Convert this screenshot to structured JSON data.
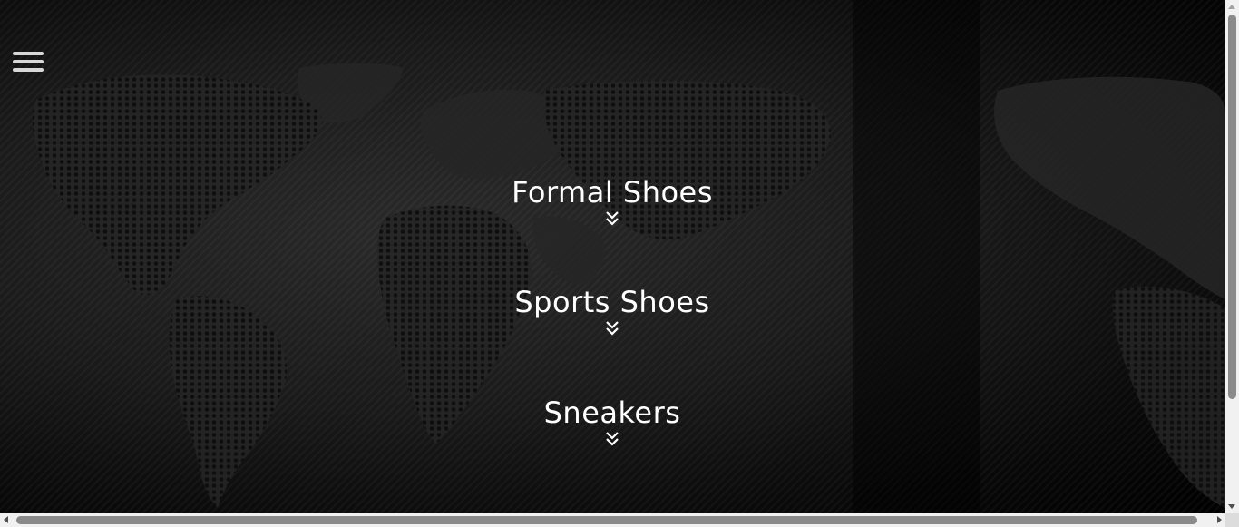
{
  "nav": {
    "menu_icon": "hamburger-menu-icon"
  },
  "categories": [
    {
      "label": "Formal Shoes",
      "icon": "double-chevron-down-icon"
    },
    {
      "label": "Sports Shoes",
      "icon": "double-chevron-down-icon"
    },
    {
      "label": "Sneakers",
      "icon": "double-chevron-down-icon"
    }
  ],
  "colors": {
    "background": "#000000",
    "text": "#ffffff",
    "menu_icon": "#d8d8d8"
  }
}
